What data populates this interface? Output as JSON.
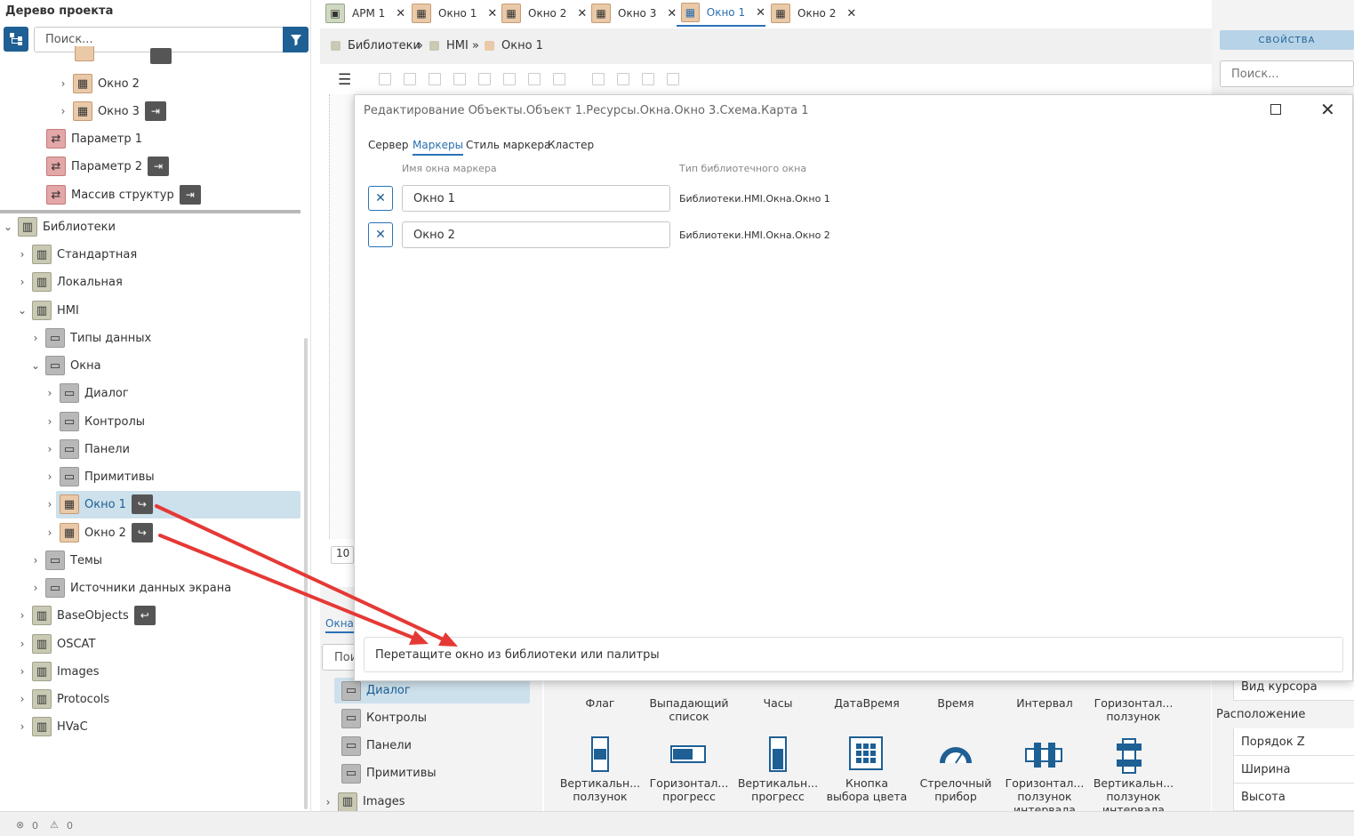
{
  "tree": {
    "title": "Дерево проекта",
    "search_placeholder": "Поиск...",
    "items": [
      {
        "label": "Окно 2",
        "icon": "window-icon"
      },
      {
        "label": "Окно 3",
        "icon": "window-icon"
      },
      {
        "label": "Параметр 1",
        "icon": "parameter-icon"
      },
      {
        "label": "Параметр 2",
        "icon": "parameter-icon"
      },
      {
        "label": "Массив структур",
        "icon": "parameter-icon"
      },
      {
        "label": "Библиотеки",
        "icon": "libraries-icon"
      },
      {
        "label": "Стандартная",
        "icon": "library-icon"
      },
      {
        "label": "Локальная",
        "icon": "library-icon"
      },
      {
        "label": "HMI",
        "icon": "library-icon"
      },
      {
        "label": "Типы данных",
        "icon": "folder-icon"
      },
      {
        "label": "Окна",
        "icon": "folder-icon"
      },
      {
        "label": "Диалог",
        "icon": "folder-icon"
      },
      {
        "label": "Контролы",
        "icon": "folder-icon"
      },
      {
        "label": "Панели",
        "icon": "folder-icon"
      },
      {
        "label": "Примитивы",
        "icon": "folder-icon"
      },
      {
        "label": "Окно 1",
        "icon": "window-icon"
      },
      {
        "label": "Окно 2",
        "icon": "window-icon"
      },
      {
        "label": "Темы",
        "icon": "folder-icon"
      },
      {
        "label": "Источники данных экрана",
        "icon": "folder-icon"
      },
      {
        "label": "BaseObjects",
        "icon": "library-icon"
      },
      {
        "label": "OSCAT",
        "icon": "library-icon"
      },
      {
        "label": "Images",
        "icon": "library-icon"
      },
      {
        "label": "Protocols",
        "icon": "library-icon"
      },
      {
        "label": "HVaC",
        "icon": "library-icon"
      }
    ]
  },
  "tabs": [
    {
      "label": "АРМ 1"
    },
    {
      "label": "Окно 1"
    },
    {
      "label": "Окно 2"
    },
    {
      "label": "Окно 3"
    },
    {
      "label": "Окно 1"
    },
    {
      "label": "Окно 2"
    }
  ],
  "breadcrumb": [
    "Библиотеки",
    "HMI",
    "Окно 1"
  ],
  "breadcrumb_sep": "»",
  "modal": {
    "title": "Редактирование Объекты.Объект 1.Ресурсы.Окна.Окно 3.Схема.Карта 1",
    "tabs": [
      "Сервер",
      "Маркеры",
      "Стиль маркера",
      "Кластер"
    ],
    "col_name": "Имя окна маркера",
    "col_type": "Тип библиотечного окна",
    "rows": [
      {
        "name": "Окно 1",
        "type": "Библиотеки.HMI.Окна.Окно 1"
      },
      {
        "name": "Окно 2",
        "type": "Библиотеки.HMI.Окна.Окно 2"
      }
    ],
    "dropzone": "Перетащите окно из библиотеки или палитры"
  },
  "properties": {
    "tab": "свойства",
    "search_placeholder": "Поиск...",
    "cursor_label": "Вид курсора",
    "section": "Расположение",
    "rows": [
      "Порядок Z",
      "Ширина",
      "Высота"
    ]
  },
  "palette": {
    "tab": "Окна",
    "search_fragment": "Пои",
    "canvas_fragment": "10",
    "items": [
      "Диалог",
      "Контролы",
      "Панели",
      "Примитивы",
      "Images"
    ],
    "grid_row1": [
      "Флаг",
      "Выпадающий список",
      "Часы",
      "ДатаВремя",
      "Время",
      "Интервал",
      "Горизонтал... ползунок"
    ],
    "grid_row2": [
      "Вертикальн... ползунок",
      "Горизонтал... прогресс",
      "Вертикальн... прогресс",
      "Кнопка выбора цвета",
      "Стрелочный прибор",
      "Горизонтал... ползунок интервала",
      "Вертикальн... ползунок интервала"
    ]
  },
  "status": {
    "errors": "0",
    "warnings": "0"
  },
  "colors": {
    "accent": "#1e5f94",
    "selection": "#cde1ec",
    "arrow": "#e53935"
  }
}
